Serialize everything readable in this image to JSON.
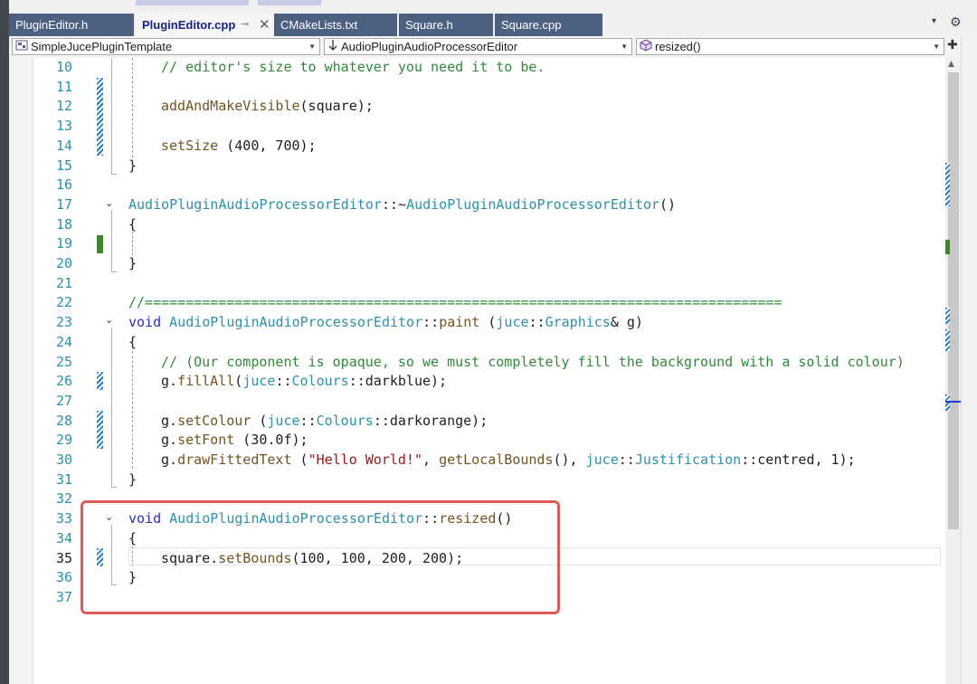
{
  "tabs": [
    {
      "label": "PluginEditor.h"
    },
    {
      "label": "PluginEditor.cpp",
      "pin": "⊸",
      "close": "✕"
    },
    {
      "label": "CMakeLists.txt"
    },
    {
      "label": "Square.h"
    },
    {
      "label": "Square.cpp"
    }
  ],
  "tabbar": {
    "overflow_icon": "▾",
    "settings_icon": "⚙"
  },
  "navbar": {
    "project": "SimpleJucePluginTemplate",
    "scope": "AudioPluginAudioProcessorEditor",
    "member": "resized()",
    "split_icon": "✚"
  },
  "editor": {
    "current_line": "35",
    "lines": [
      {
        "n": "10",
        "text": "// editor's size to whatever you need it to be."
      },
      {
        "n": "11",
        "text": ""
      },
      {
        "n": "12",
        "text": "addAndMakeVisible(square);"
      },
      {
        "n": "13",
        "text": ""
      },
      {
        "n": "14",
        "text": "setSize (400, 700);"
      },
      {
        "n": "15",
        "text": "}"
      },
      {
        "n": "16",
        "text": ""
      },
      {
        "n": "17",
        "text": "AudioPluginAudioProcessorEditor::~AudioPluginAudioProcessorEditor()"
      },
      {
        "n": "18",
        "text": "{"
      },
      {
        "n": "19",
        "text": ""
      },
      {
        "n": "20",
        "text": "}"
      },
      {
        "n": "21",
        "text": ""
      },
      {
        "n": "22",
        "text": "//=============================================================================="
      },
      {
        "n": "23",
        "text": "void AudioPluginAudioProcessorEditor::paint (juce::Graphics& g)"
      },
      {
        "n": "24",
        "text": "{"
      },
      {
        "n": "25",
        "text": "// (Our component is opaque, so we must completely fill the background with a solid colour)"
      },
      {
        "n": "26",
        "text": "g.fillAll(juce::Colours::darkblue);"
      },
      {
        "n": "27",
        "text": ""
      },
      {
        "n": "28",
        "text": "g.setColour (juce::Colours::darkorange);"
      },
      {
        "n": "29",
        "text": "g.setFont (30.0f);"
      },
      {
        "n": "30",
        "text": "g.drawFittedText (\"Hello World!\", getLocalBounds(), juce::Justification::centred, 1);"
      },
      {
        "n": "31",
        "text": "}"
      },
      {
        "n": "32",
        "text": ""
      },
      {
        "n": "33",
        "text": "void AudioPluginAudioProcessorEditor::resized()"
      },
      {
        "n": "34",
        "text": "{"
      },
      {
        "n": "35",
        "text": "square.setBounds(100, 100, 200, 200);"
      },
      {
        "n": "36",
        "text": "}"
      },
      {
        "n": "37",
        "text": ""
      }
    ]
  },
  "colors": {
    "comment": "#2f8a3a",
    "keyword": "#2c2cd6",
    "type": "#2b91af",
    "function": "#74531f",
    "string": "#a31515",
    "line_number": "#2b91af",
    "highlight_box": "#e05a52",
    "saved_change": "#1f7fd4",
    "unsaved_change": "#3a8a22",
    "tab_inactive": "#4d6082",
    "tab_active_text": "#15238c"
  }
}
